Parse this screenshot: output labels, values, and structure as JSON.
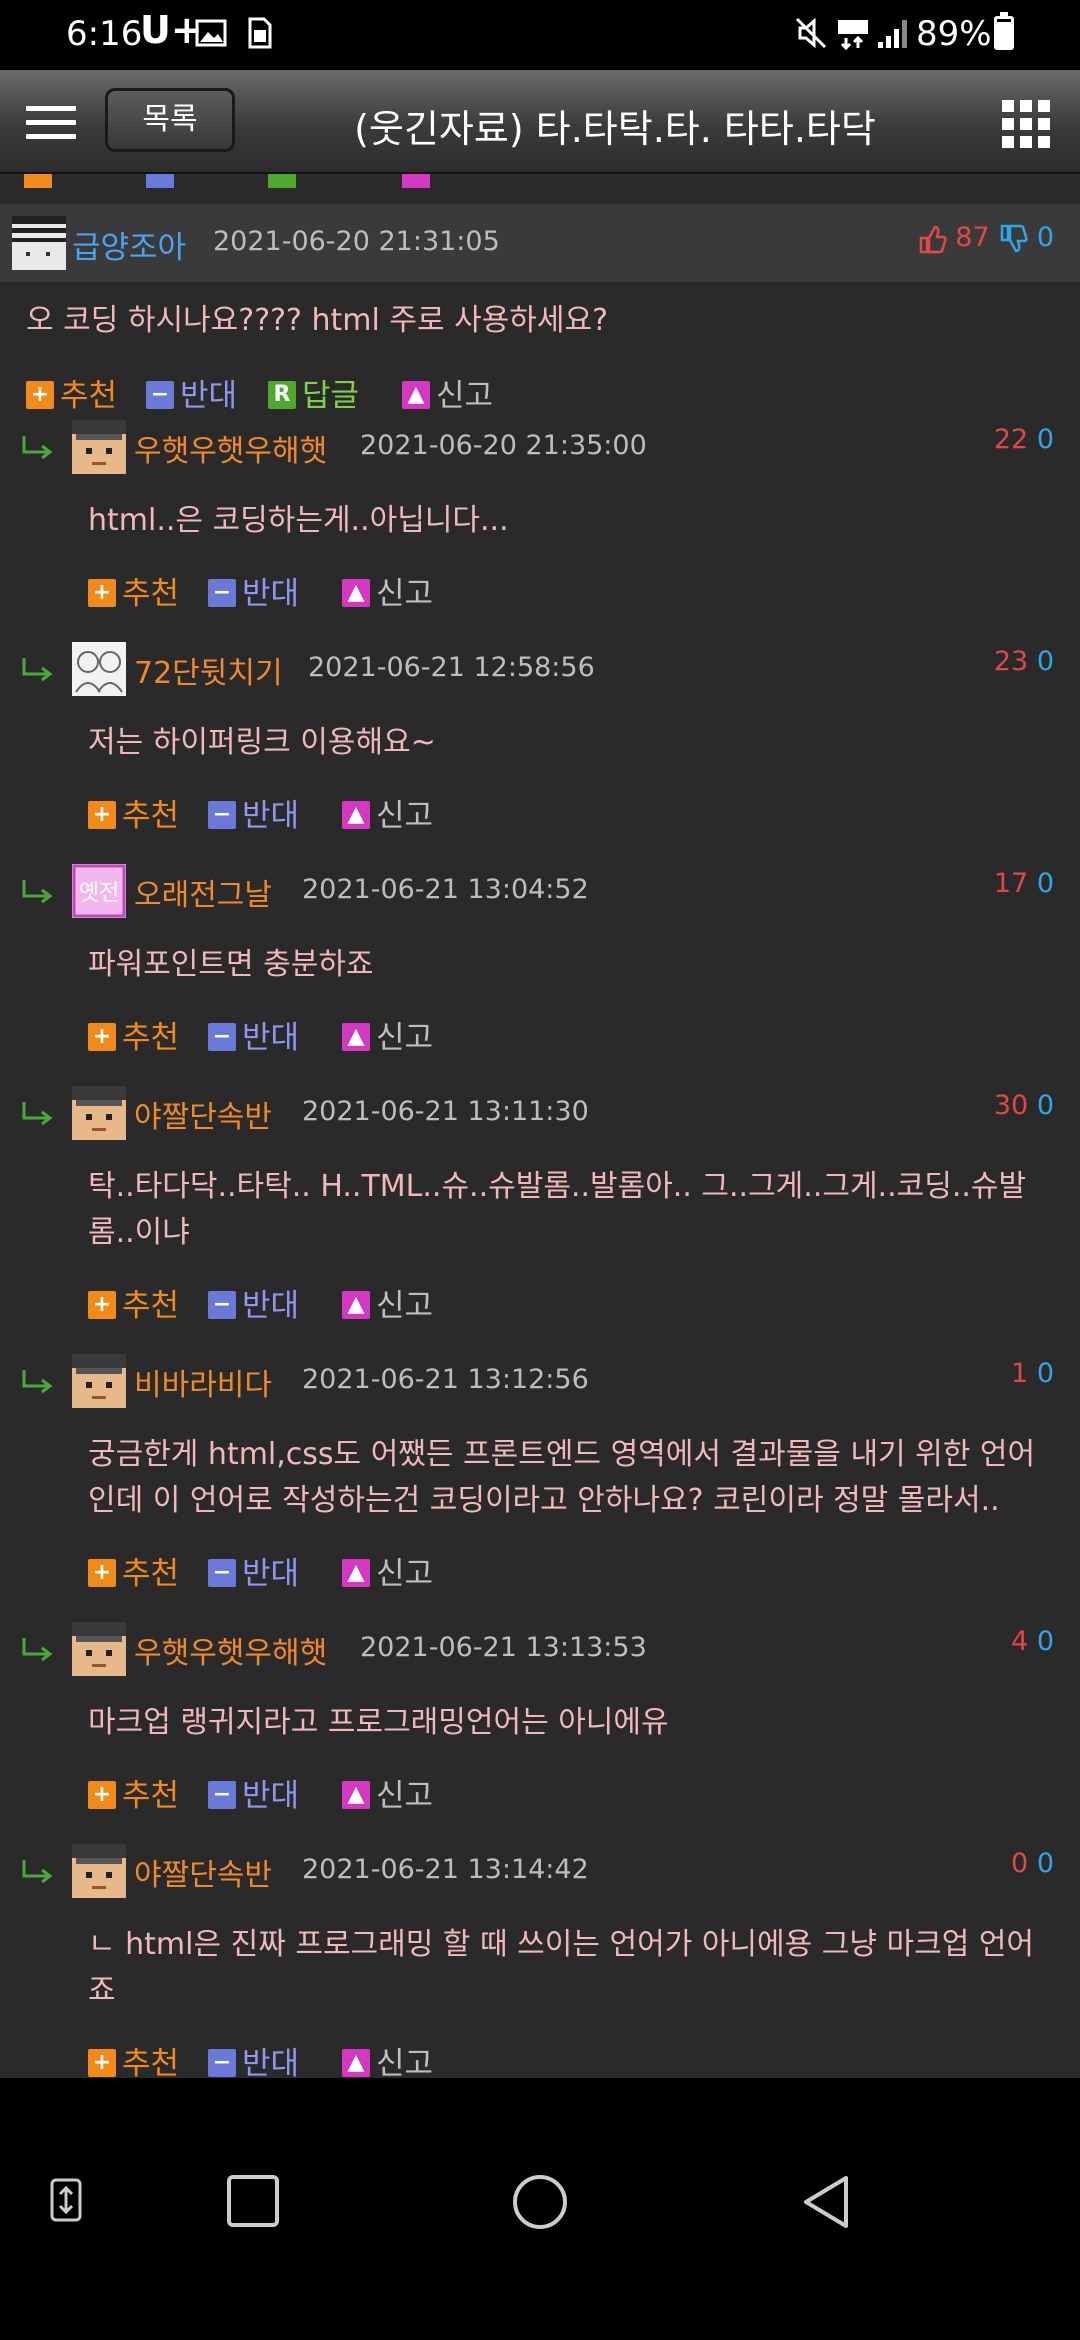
{
  "status": {
    "time": "6:16",
    "carrier": "U+",
    "battery": "89%",
    "battery_level": 0.89
  },
  "header": {
    "back_label": "목록",
    "title": "(웃긴자료) 타.타탁.타. 타타.타닥"
  },
  "actions": {
    "recommend": "추천",
    "oppose": "반대",
    "reply": "답글",
    "report": "신고",
    "reply_badge": "R"
  },
  "main_comment": {
    "nick": "급양조아",
    "date": "2021-06-20 21:31:05",
    "up": "87",
    "down": "0",
    "text": "오 코딩 하시나요???? html 주로 사용하세요?"
  },
  "replies": [
    {
      "nick": "우햇우햇우해햇",
      "date": "2021-06-20 21:35:00",
      "up": "22",
      "down": "0",
      "text": "html..은 코딩하는게..아닙니다..."
    },
    {
      "nick": "72단뒷치기",
      "date": "2021-06-21 12:58:56",
      "up": "23",
      "down": "0",
      "text": "저는 하이퍼링크 이용해요~"
    },
    {
      "nick": "오래전그날",
      "date": "2021-06-21 13:04:52",
      "up": "17",
      "down": "0",
      "text": "파워포인트면 충분하죠",
      "avatar_text": "옛전"
    },
    {
      "nick": "야짤단속반",
      "date": "2021-06-21 13:11:30",
      "up": "30",
      "down": "0",
      "text_lines": [
        "탁..타다닥..타탁.. H..TML..슈..슈발롬..발롬아.. 그..그게..그게..코딩..슈발",
        "롬..이냐"
      ]
    },
    {
      "nick": "비바라비다",
      "date": "2021-06-21 13:12:56",
      "up": "1",
      "down": "0",
      "text_lines": [
        "궁금한게 html,css도 어쨌든 프론트엔드 영역에서 결과물을 내기 위한 언어",
        "인데 이 언어로 작성하는건 코딩이라고 안하나요? 코린이라 정말 몰라서.."
      ]
    },
    {
      "nick": "우햇우햇우해햇",
      "date": "2021-06-21 13:13:53",
      "up": "4",
      "down": "0",
      "text": "마크업 랭귀지라고 프로그래밍언어는 아니에유"
    },
    {
      "nick": "야짤단속반",
      "date": "2021-06-21 13:14:42",
      "up": "0",
      "down": "0",
      "text_lines": [
        "ㄴ html은 진짜 프로그래밍 할 때 쓰이는 언어가 아니에용 그냥 마크업 언어",
        "죠"
      ]
    }
  ],
  "colors": {
    "nick_main": "#4aa3f0",
    "nick_reply": "#f0892a",
    "comment_text": "#f0b8b8",
    "up_vote": "#e04848",
    "down_vote": "#2fa7e6",
    "recommend": "#f28a1a",
    "oppose": "#6a78d8",
    "reply": "#4ea82e",
    "report": "#d438c2"
  },
  "icons": [
    "menu-icon",
    "grid-menu-icon",
    "thumbs-up-icon",
    "thumbs-down-icon",
    "reply-arrow-icon",
    "mute-icon",
    "lte-icon",
    "signal-icon",
    "battery-icon",
    "image-icon",
    "sim-icon",
    "rotate-icon",
    "recents-icon",
    "home-icon",
    "back-icon"
  ]
}
